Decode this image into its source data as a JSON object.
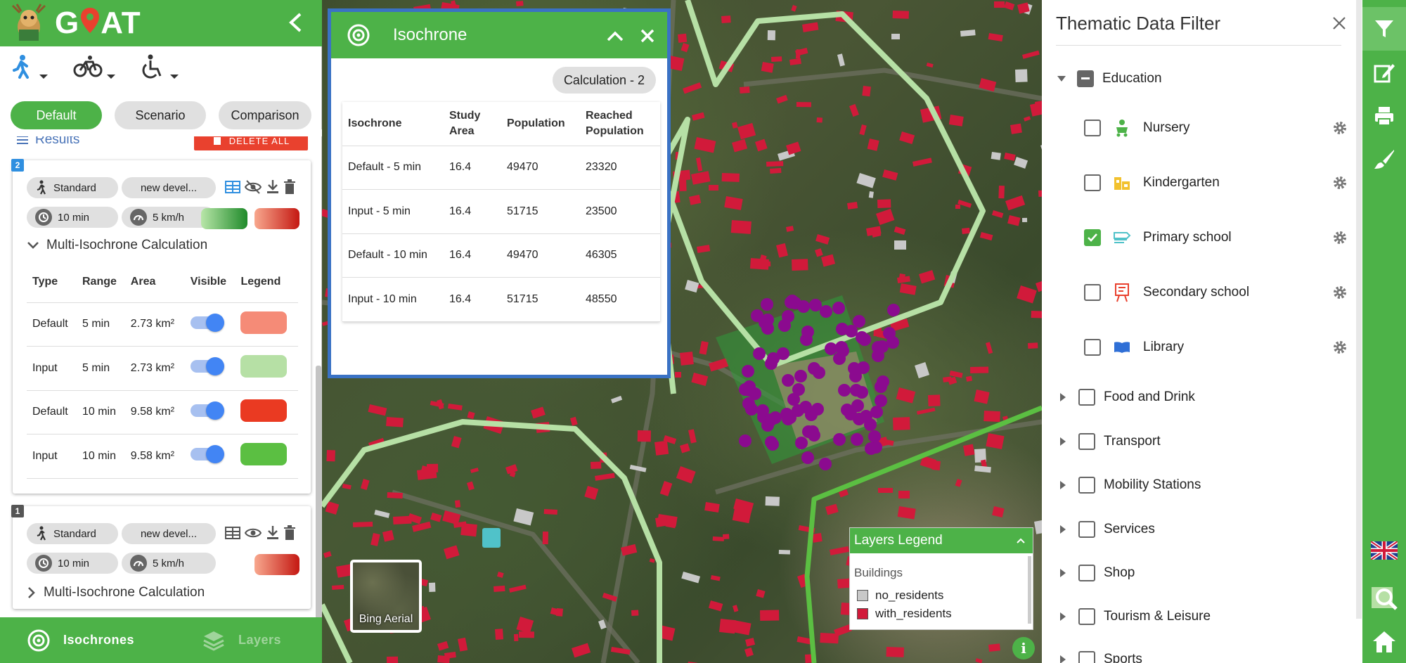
{
  "app": {
    "name": "GOAT",
    "name_pre": "G",
    "name_post": "AT"
  },
  "tabs": [
    "Default",
    "Scenario",
    "Comparison"
  ],
  "results": {
    "label": "Results",
    "delete_all": "DELETE ALL"
  },
  "cards": [
    {
      "number": "2",
      "profile": "Standard",
      "scenario": "new devel...",
      "time": "10 min",
      "speed": "5 km/h",
      "section_title": "Multi-Isochrone Calculation",
      "expanded": true,
      "table": {
        "headers": [
          "Type",
          "Range",
          "Area",
          "Visible",
          "Legend"
        ],
        "rows": [
          {
            "type": "Default",
            "range": "5 min",
            "area": "2.73 km²",
            "visible": true,
            "color": "#f58b77"
          },
          {
            "type": "Input",
            "range": "5 min",
            "area": "2.73 km²",
            "visible": true,
            "color": "#b6e0a5"
          },
          {
            "type": "Default",
            "range": "10 min",
            "area": "9.58 km²",
            "visible": true,
            "color": "#ea3a22"
          },
          {
            "type": "Input",
            "range": "10 min",
            "area": "9.58 km²",
            "visible": true,
            "color": "#5bbf42"
          }
        ]
      }
    },
    {
      "number": "1",
      "profile": "Standard",
      "scenario": "new devel...",
      "time": "10 min",
      "speed": "5 km/h",
      "section_title": "Multi-Isochrone Calculation",
      "expanded": false
    }
  ],
  "bottom_nav": {
    "isochrones": "Isochrones",
    "layers": "Layers"
  },
  "popup": {
    "title": "Isochrone",
    "chip": "Calculation - 2",
    "headers": [
      "Isochrone",
      "Study Area",
      "Population",
      "Reached Population"
    ],
    "rows": [
      [
        "Default - 5 min",
        "16.4",
        "49470",
        "23320"
      ],
      [
        "Input - 5 min",
        "16.4",
        "51715",
        "23500"
      ],
      [
        "Default - 10 min",
        "16.4",
        "49470",
        "46305"
      ],
      [
        "Input - 10 min",
        "16.4",
        "51715",
        "48550"
      ]
    ]
  },
  "filter": {
    "title": "Thematic Data Filter",
    "education": {
      "label": "Education",
      "state": "indeterminate"
    },
    "education_items": [
      {
        "label": "Nursery",
        "checked": false,
        "icon": "nursery-icon",
        "color": "#4db248"
      },
      {
        "label": "Kindergarten",
        "checked": false,
        "icon": "kindergarten-icon",
        "color": "#f2c12e"
      },
      {
        "label": "Primary school",
        "checked": true,
        "icon": "primary-school-icon",
        "color": "#50c2c9"
      },
      {
        "label": "Secondary school",
        "checked": false,
        "icon": "secondary-school-icon",
        "color": "#e9412e"
      },
      {
        "label": "Library",
        "checked": false,
        "icon": "library-icon",
        "color": "#2f6fd6"
      }
    ],
    "categories": [
      "Food and Drink",
      "Transport",
      "Mobility Stations",
      "Services",
      "Shop",
      "Tourism & Leisure",
      "Sports"
    ]
  },
  "legend": {
    "title": "Layers Legend",
    "group": "Buildings",
    "items": [
      {
        "label": "no_residents",
        "color": "#c8c8c8"
      },
      {
        "label": "with_residents",
        "color": "#d11a3a"
      }
    ]
  },
  "basemap": {
    "label": "Bing Aerial"
  },
  "info": "i"
}
